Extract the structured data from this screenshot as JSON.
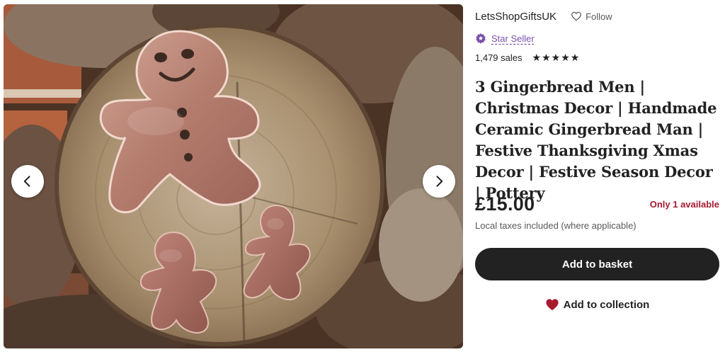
{
  "gallery": {
    "prev_icon": "chevron-left-icon",
    "next_icon": "chevron-right-icon"
  },
  "shop": {
    "name": "LetsShopGiftsUK",
    "follow_label": "Follow",
    "follow_icon": "heart-outline-icon"
  },
  "badge": {
    "label": "Star Seller",
    "icon": "star-seller-badge-icon",
    "color": "#7851a9"
  },
  "reviews": {
    "sales": "1,479 sales",
    "rating_stars": 5
  },
  "listing": {
    "title": "3 Gingerbread Men | Christmas Decor | Handmade Ceramic Gingerbread Man | Festive Thanksgiving Xmas Decor | Festive Season Decor | Pottery",
    "price": "£15.00",
    "availability": "Only 1 available",
    "tax_note": "Local taxes included (where applicable)"
  },
  "actions": {
    "add_to_basket": "Add to basket",
    "add_to_collection": "Add to collection",
    "collection_icon": "heart-filled-icon"
  },
  "colors": {
    "primary_button": "#222222",
    "availability": "#a61a2e",
    "heart": "#a61a2e"
  }
}
